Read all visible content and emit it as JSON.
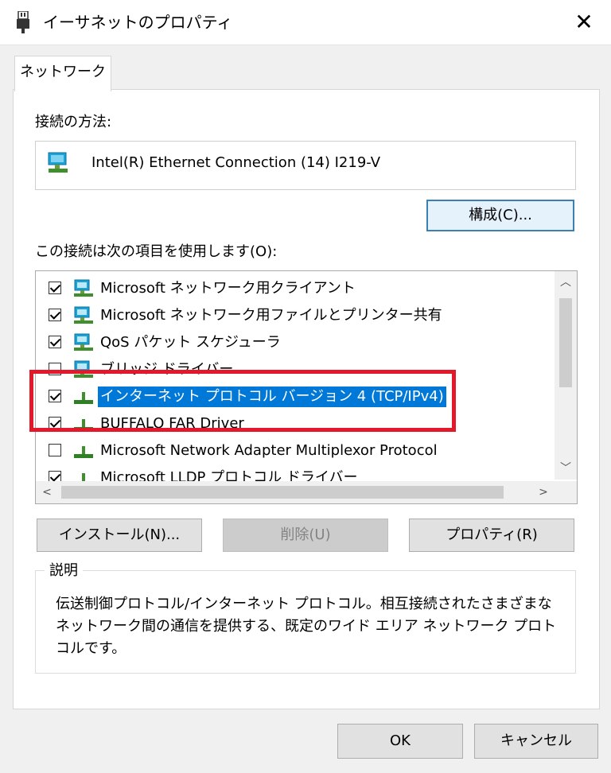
{
  "window": {
    "title": "イーサネットのプロパティ",
    "close_glyph": "✕"
  },
  "tabs": [
    "ネットワーク"
  ],
  "connection": {
    "label": "接続の方法:",
    "adapter": "Intel(R) Ethernet Connection (14) I219-V",
    "adapter_icon": "network-adapter-icon"
  },
  "buttons": {
    "configure": "構成(C)...",
    "install": "インストール(N)...",
    "uninstall": "削除(U)",
    "properties": "プロパティ(R)",
    "ok": "OK",
    "cancel": "キャンセル"
  },
  "items_label": "この接続は次の項目を使用します(O):",
  "items": [
    {
      "label": "Microsoft ネットワーク用クライアント",
      "checked": true,
      "icon": "client-icon"
    },
    {
      "label": "Microsoft ネットワーク用ファイルとプリンター共有",
      "checked": true,
      "icon": "client-icon"
    },
    {
      "label": "QoS パケット スケジューラ",
      "checked": true,
      "icon": "client-icon"
    },
    {
      "label": "ブリッジ ドライバー",
      "checked": false,
      "icon": "client-icon"
    },
    {
      "label": "インターネット プロトコル バージョン 4 (TCP/IPv4)",
      "checked": true,
      "icon": "protocol-icon",
      "selected": true
    },
    {
      "label": "BUFFALO FAR Driver",
      "checked": true,
      "icon": "protocol-icon"
    },
    {
      "label": "Microsoft Network Adapter Multiplexor Protocol",
      "checked": false,
      "icon": "protocol-icon"
    },
    {
      "label": "Microsoft LLDP プロトコル ドライバー",
      "checked": true,
      "icon": "protocol-icon"
    }
  ],
  "description": {
    "title": "説明",
    "text": "伝送制御プロトコル/インターネット プロトコル。相互接続されたさまざまなネットワーク間の通信を提供する、既定のワイド エリア ネットワーク プロトコルです。"
  },
  "colors": {
    "selection": "#0078d7",
    "highlight_box": "#e3182b",
    "focus_border": "#3c7fb1"
  }
}
